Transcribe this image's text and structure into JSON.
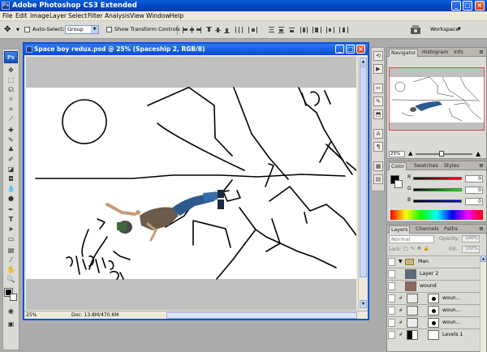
{
  "app": {
    "title": "Adobe Photoshop CS3 Extended",
    "badge": "Ps"
  },
  "window_controls": {
    "minimize": "_",
    "maximize": "□",
    "close": "×"
  },
  "menu": [
    "File",
    "Edit",
    "Image",
    "Layer",
    "Select",
    "Filter",
    "Analysis",
    "View",
    "Window",
    "Help"
  ],
  "options": {
    "autoselect_label": "Auto-Select:",
    "autoselect_value": "Group",
    "transform_label": "Show Transform Controls",
    "workspace_label": "Workspace"
  },
  "toolbox": {
    "badge": "Ps"
  },
  "document": {
    "title": "Space boy redux.psd @ 25% (Spaceship 2, RGB/8)",
    "zoom": "25%",
    "doc_info": "Doc: 13.8M/470.6M"
  },
  "navigator": {
    "tabs": [
      "Navigator",
      "Histogram",
      "Info"
    ],
    "zoom": "25%",
    "zoom_slider_fraction": 0.45
  },
  "color_panel": {
    "tabs": [
      "Color",
      "Swatches",
      "Styles"
    ],
    "channels": [
      {
        "label": "R",
        "value": "0",
        "fraction": 0.0
      },
      {
        "label": "G",
        "value": "0",
        "fraction": 0.0
      },
      {
        "label": "B",
        "value": "0",
        "fraction": 0.0
      }
    ],
    "colors": {
      "r_track": "#ff0000",
      "g_track": "#00ff00",
      "b_track": "#0000ff"
    }
  },
  "layers": {
    "tabs": [
      "Layers",
      "Channels",
      "Paths"
    ],
    "blend_mode": "Normal",
    "opacity_label": "Opacity:",
    "opacity_value": "100%",
    "lock_label": "Lock:",
    "fill_label": "Fill:",
    "fill_value": "100%",
    "rows": [
      {
        "name": "Man",
        "type": "group"
      },
      {
        "name": "Layer 2",
        "type": "layer"
      },
      {
        "name": "wound",
        "type": "group"
      },
      {
        "name": "woun...",
        "type": "masked"
      },
      {
        "name": "woun...",
        "type": "masked"
      },
      {
        "name": "woun...",
        "type": "masked"
      },
      {
        "name": "Levels 1",
        "type": "adjustment"
      }
    ]
  }
}
